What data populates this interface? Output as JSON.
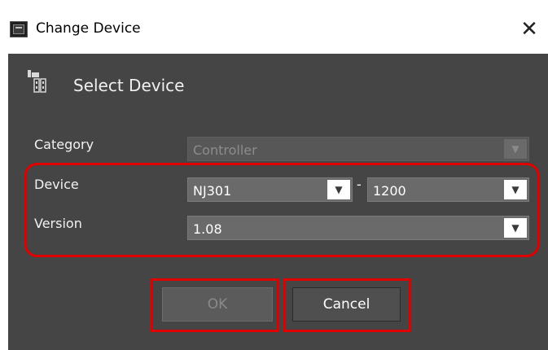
{
  "window": {
    "title": "Change Device",
    "close_glyph": "✕"
  },
  "section": {
    "title": "Select Device"
  },
  "form": {
    "category_label": "Category",
    "category_value": "Controller",
    "category_enabled": false,
    "device_label": "Device",
    "device_value": "NJ301",
    "device_separator": "-",
    "device_variant_value": "1200",
    "version_label": "Version",
    "version_value": "1.08"
  },
  "buttons": {
    "ok_label": "OK",
    "ok_enabled": false,
    "cancel_label": "Cancel"
  },
  "icons": {
    "app": "app-window-icon",
    "section": "device-hardware-icon",
    "dropdown": "chevron-down-icon",
    "close": "close-icon"
  },
  "colors": {
    "panel_bg": "#454545",
    "highlight": "#e00000",
    "field_bg": "#6a6a6a"
  }
}
